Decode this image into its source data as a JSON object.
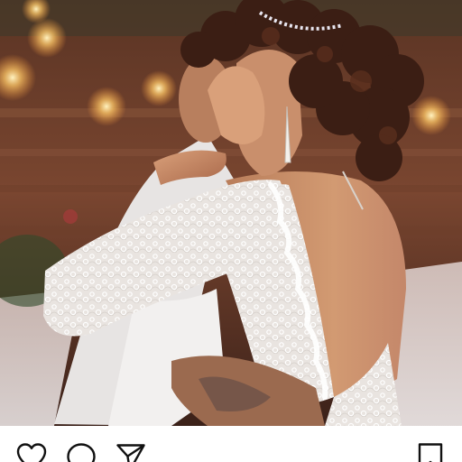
{
  "post": {
    "image_subject": "bride-and-groom-embrace",
    "colors": {
      "background": "#ffffff",
      "icon_stroke": "#111111",
      "lace": "#f2f0ee",
      "warm_light": "#ffd27a"
    }
  },
  "actions": {
    "like_icon": "heart-icon",
    "comment_icon": "comment-icon",
    "share_icon": "send-icon",
    "save_icon": "bookmark-icon"
  }
}
